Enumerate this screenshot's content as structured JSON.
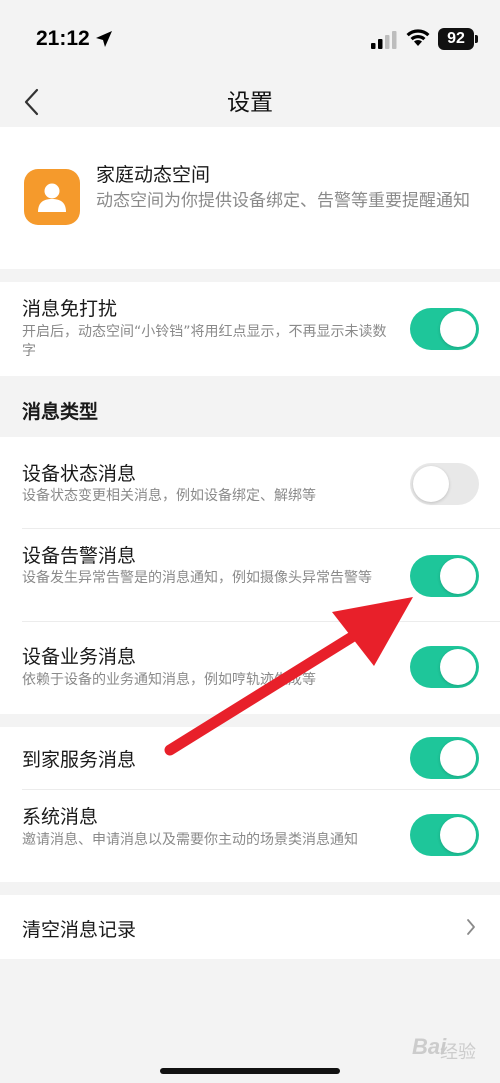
{
  "status_bar": {
    "time": "21:12",
    "battery": "92"
  },
  "nav": {
    "title": "设置"
  },
  "app_info": {
    "name": "家庭动态空间",
    "description": "动态空间为你提供设备绑定、告警等重要提醒通知",
    "icon": "user-icon",
    "icon_color": "#f59a2c"
  },
  "dnd": {
    "title": "消息免打扰",
    "description": "开启后，动态空间“小铃铛”将用红点显示，不再显示未读数字",
    "enabled": true
  },
  "message_types": {
    "header": "消息类型",
    "items": [
      {
        "title": "设备状态消息",
        "description": "设备状态变更相关消息，例如设备绑定、解绑等",
        "enabled": false
      },
      {
        "title": "设备告警消息",
        "description": "设备发生异常告警是的消息通知，例如摄像头异常告警等",
        "enabled": true
      },
      {
        "title": "设备业务消息",
        "description": "依赖于设备的业务通知消息，例如哼轨迹生成等",
        "enabled": true
      }
    ]
  },
  "other_messages": [
    {
      "title": "到家服务消息",
      "enabled": true
    },
    {
      "title": "系统消息",
      "description": "邀请消息、申请消息以及需要你主动的场景类消息通知",
      "enabled": true
    }
  ],
  "clear": {
    "label": "清空消息记录"
  },
  "watermark": {
    "text": "Bai",
    "sub": "经验"
  },
  "colors": {
    "accent": "#1ec69a",
    "annotation_arrow": "#e8202a"
  }
}
